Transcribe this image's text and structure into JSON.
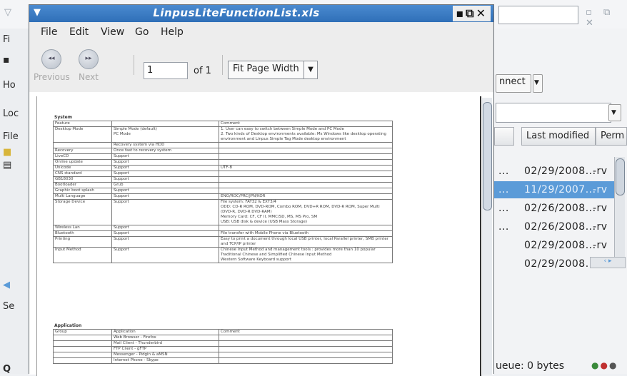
{
  "background_window": {
    "left_strip_labels": [
      "Fi",
      "Ho",
      "Loc",
      "File",
      "Se",
      "Q"
    ],
    "connect_button": "nnect",
    "columns": [
      "Last modified",
      "Perm"
    ],
    "rows": [
      {
        "dots": "...",
        "date": "02/29/2008...",
        "perm": "-rv",
        "selected": false
      },
      {
        "dots": "...",
        "date": "11/29/2007...",
        "perm": "-rv",
        "selected": true
      },
      {
        "dots": "...",
        "date": "02/26/2008...",
        "perm": "-rv",
        "selected": false
      },
      {
        "dots": "...",
        "date": "02/26/2008...",
        "perm": "-rv",
        "selected": false
      },
      {
        "dots": "",
        "date": "02/29/2008...",
        "perm": "-rv",
        "selected": false
      },
      {
        "dots": "",
        "date": "02/29/2008...",
        "perm": "-rv",
        "selected": false
      }
    ],
    "status": "ueue: 0 bytes"
  },
  "viewer": {
    "title": "LinpusLiteFunctionList.xls",
    "menu": [
      "File",
      "Edit",
      "View",
      "Go",
      "Help"
    ],
    "toolbar": {
      "previous": "Previous",
      "next": "Next",
      "page_value": "1",
      "page_of": "of 1",
      "zoom": "Fit Page Width"
    },
    "document": {
      "system_title": "System",
      "system_headers": [
        "Feature",
        "",
        "Comment"
      ],
      "system_rows": [
        [
          "Desktop Mode",
          "Simple Mode (default)\nPC Mode",
          "1. User can easy to switch between Simple Mode and PC Mode\n2. Two kinds of Desktop environments available: Ms Windows like desktop operating environment and Linpus Simple Tag Mode desktop environment"
        ],
        [
          "",
          "Recovery system via HDD",
          ""
        ],
        [
          "Recovery",
          "Once fast to recovery system",
          ""
        ],
        [
          "LiveCD",
          "Support",
          ""
        ],
        [
          "Online update",
          "Support",
          ""
        ],
        [
          "Unicode",
          "Support",
          "UTF-8"
        ],
        [
          "CNS standard",
          "Support",
          ""
        ],
        [
          "GB18030",
          "Support",
          ""
        ],
        [
          "Bootloader",
          "Grub",
          ""
        ],
        [
          "Graphic boot splash",
          "Support",
          ""
        ],
        [
          "Multi Language",
          "Support",
          "ENG/ROC/PRC/JPN/KOR"
        ],
        [
          "Storage Device",
          "Support",
          "File system: FAT32 & EXT3/4\nODD: CD-R ROM, DVD-ROM, Combo ROM, DVD+R ROM, DVD-R ROM, Super Multi (DVD-R, DVD-R DVD-RAM)\nMemory Card: CF, CF II, MMC/SD, MS, MS Pro, SM\nUSB: USB disk & device (USB Mass Storage)"
        ],
        [
          "Wireless Lan",
          "Support",
          ""
        ],
        [
          "Bluetooth",
          "Support",
          "File transfer with Mobile Phone via Bluetooth"
        ],
        [
          "Printing",
          "Support",
          "Easy to print a document through local USB printer, local Parallel printer, SMB printer and TCP/IP printer"
        ],
        [
          "Input Method",
          "Support",
          "Chinese Input Method and management tools : provides more than 10 popular Traditional Chinese and Simplified Chinese Input Method\nWestern Software Keyboard support"
        ]
      ],
      "application_title": "Application",
      "application_headers": [
        "Group",
        "Application",
        "Comment"
      ],
      "application_rows": [
        [
          "",
          "Web Browser - Firefox",
          ""
        ],
        [
          "",
          "Mail Client - Thunderbird",
          ""
        ],
        [
          "",
          "FTP Client - gFTP",
          ""
        ],
        [
          "",
          "Messenger - Pidgin & aMSN",
          ""
        ],
        [
          "",
          "Internet Phone - Skype",
          ""
        ]
      ]
    }
  },
  "colors": {
    "titlebar": "#3a7cc6",
    "selection": "#5b9bd8",
    "disabled_text": "#a8a8a8"
  }
}
